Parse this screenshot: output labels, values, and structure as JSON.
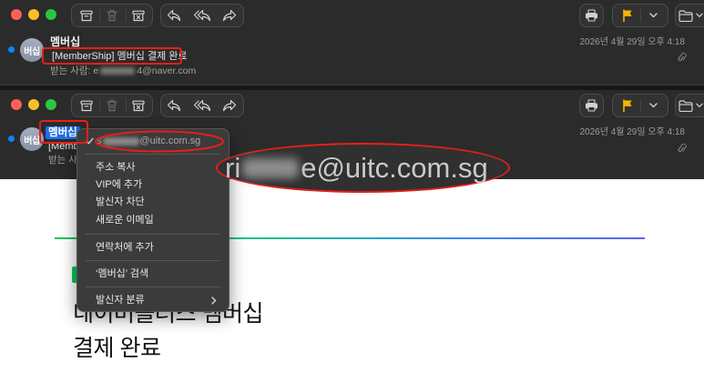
{
  "toolbar": {
    "icons": [
      "archive-icon",
      "trash-icon",
      "junk-icon",
      "reply-icon",
      "reply-all-icon",
      "forward-icon",
      "print-icon",
      "flag-icon",
      "chevron-down-icon",
      "folder-icon"
    ]
  },
  "message_top": {
    "avatar_initials": "버십",
    "sender": "멤버십",
    "subject": "[MemberShip] 멤버십 결제 완료",
    "to_label": "받는 사람: ",
    "to_visible_start": "e",
    "to_visible_end": "4@naver.com",
    "date": "2026년 4월 29일 오후 4:18"
  },
  "message_bottom": {
    "avatar_initials": "버십",
    "sender": "멤버십",
    "subject_visible": "[Memb",
    "to_label_visible": "받는 사",
    "date": "2026년 4월 29일 오후 4:18"
  },
  "context_menu": {
    "address_visible_start": "s",
    "address_visible_end": "@uitc.com.sg",
    "items": [
      {
        "label": "주소 복사"
      },
      {
        "label": "VIP에 추가"
      },
      {
        "label": "발신자 차단"
      },
      {
        "label": "새로운 이메일"
      },
      {
        "label": "연락처에 추가"
      },
      {
        "label": "‘멤버십’ 검색"
      },
      {
        "label": "발신자 분류",
        "submenu": true
      }
    ]
  },
  "zoom_callout": {
    "address_visible_start": "ri",
    "address_visible_end": "e@uitc.com.sg"
  },
  "email_body": {
    "heading_line1": "네이버플러스 멤버십",
    "heading_line2": "결제 완료"
  },
  "colors": {
    "accent": "#0a84ff",
    "selection": "#1f6feb",
    "flag": "#f6b500",
    "annotation_red": "#e3201b",
    "naver_green": "#03c75a"
  }
}
